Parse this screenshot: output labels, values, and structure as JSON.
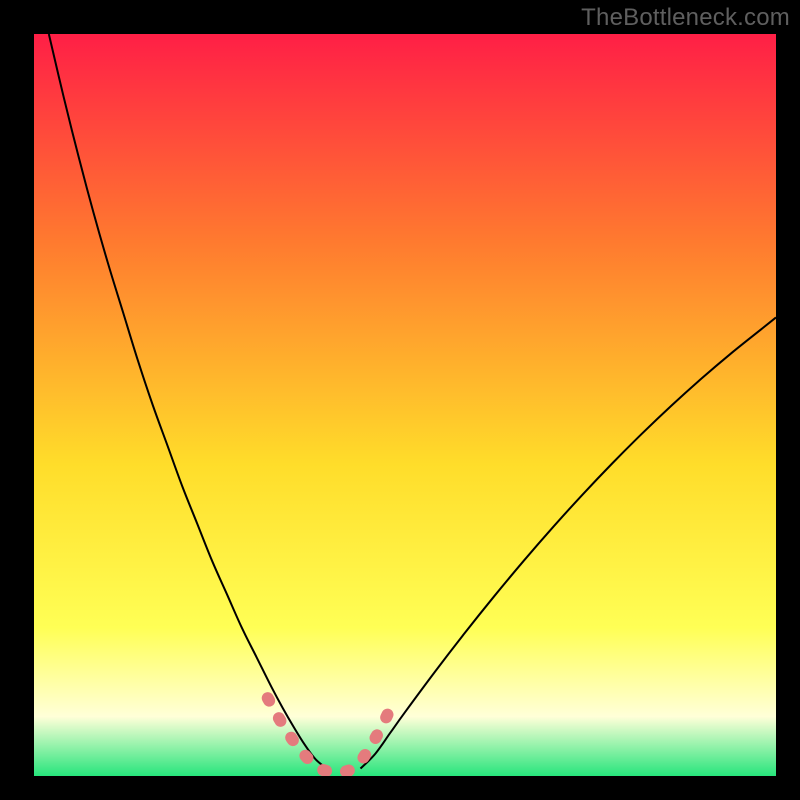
{
  "watermark": "TheBottleneck.com",
  "colors": {
    "frame_bg": "#000000",
    "gradient_top": "#ff1f46",
    "gradient_mid1": "#ff7a2f",
    "gradient_mid2": "#ffdd2a",
    "gradient_mid3": "#ffff55",
    "gradient_pale": "#ffffd8",
    "gradient_green": "#27e57c",
    "curve_stroke": "#000000",
    "overlay_stroke": "#e47b7d"
  },
  "chart_data": {
    "type": "line",
    "title": "",
    "xlabel": "",
    "ylabel": "",
    "xlim": [
      0,
      100
    ],
    "ylim": [
      0,
      100
    ],
    "series": [
      {
        "name": "left-curve",
        "x": [
          2,
          4,
          6,
          8,
          10,
          12,
          14,
          16,
          18,
          20,
          22,
          24,
          26,
          28,
          30,
          32,
          33.5,
          35,
          36.5,
          38,
          40
        ],
        "y": [
          100,
          91.5,
          83.5,
          76,
          69,
          62.5,
          56,
          50,
          44.5,
          39,
          34,
          29,
          24.5,
          20,
          16,
          12,
          9.2,
          6.6,
          4.2,
          2.2,
          0.6
        ]
      },
      {
        "name": "right-curve",
        "x": [
          44,
          46,
          48,
          50,
          54,
          58,
          62,
          66,
          70,
          74,
          78,
          82,
          86,
          90,
          94,
          98,
          100
        ],
        "y": [
          1.0,
          3.0,
          5.8,
          8.6,
          14,
          19.2,
          24.2,
          29,
          33.6,
          38,
          42.2,
          46.2,
          50,
          53.6,
          57,
          60.2,
          61.8
        ]
      },
      {
        "name": "valley-overlay",
        "x": [
          31.5,
          33,
          34.5,
          36,
          37.5,
          39,
          40.5,
          42,
          43.5,
          45,
          46.5,
          48
        ],
        "y": [
          10.5,
          7.8,
          5.4,
          3.4,
          1.8,
          0.8,
          0.6,
          0.6,
          1.4,
          3.4,
          6.0,
          9.0
        ]
      }
    ]
  }
}
